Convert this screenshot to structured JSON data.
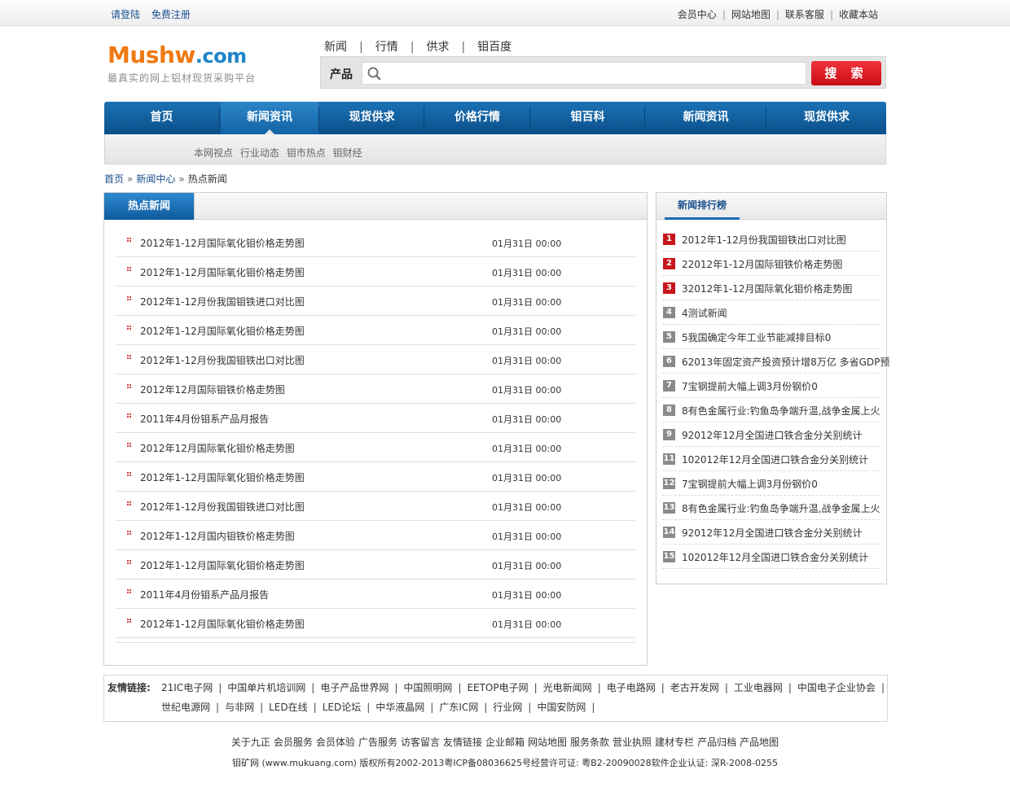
{
  "topbar": {
    "login": "请登陆",
    "register": "免费注册",
    "links": [
      "会员中心",
      "网站地图",
      "联系客服",
      "收藏本站"
    ]
  },
  "logo": {
    "brand_main": "Mushw",
    "brand_suffix": ".com",
    "slogan": "最真实的网上铝材现货采购平台"
  },
  "search": {
    "tabs": [
      "新闻",
      "行情",
      "供求",
      "钼百度"
    ],
    "category": "产品",
    "placeholder": "",
    "button": "搜 索"
  },
  "mainnav": [
    "首页",
    "新闻资讯",
    "现货供求",
    "价格行情",
    "钼百科",
    "新闻资讯",
    "现货供求"
  ],
  "subnav": [
    "本网视点",
    "行业动态",
    "钼市热点",
    "钼财经"
  ],
  "breadcrumb": {
    "home": "首页",
    "center": "新闻中心",
    "current": "热点新闻",
    "separator": "»"
  },
  "hot_news": {
    "title": "热点新闻",
    "items": [
      {
        "title": "2012年1-12月国际氧化钼价格走势图",
        "date": "01月31日 00:00"
      },
      {
        "title": "2012年1-12月国际氧化钼价格走势图",
        "date": "01月31日 00:00"
      },
      {
        "title": "2012年1-12月份我国钼铁进口对比图",
        "date": "01月31日 00:00"
      },
      {
        "title": "2012年1-12月国际氧化钼价格走势图",
        "date": "01月31日 00:00"
      },
      {
        "title": "2012年1-12月份我国钼铁出口对比图",
        "date": "01月31日 00:00"
      },
      {
        "title": "2012年12月国际钼铁价格走势图",
        "date": "01月31日 00:00"
      },
      {
        "title": "2011年4月份钼系产品月报告",
        "date": "01月31日 00:00"
      },
      {
        "title": "2012年12月国际氧化钼价格走势图",
        "date": "01月31日 00:00"
      },
      {
        "title": "2012年1-12月国际氧化钼价格走势图",
        "date": "01月31日 00:00"
      },
      {
        "title": "2012年1-12月份我国钼铁进口对比图",
        "date": "01月31日 00:00"
      },
      {
        "title": "2012年1-12月国内钼铁价格走势图",
        "date": "01月31日 00:00"
      },
      {
        "title": "2012年1-12月国际氧化钼价格走势图",
        "date": "01月31日 00:00"
      },
      {
        "title": "2011年4月份钼系产品月报告",
        "date": "01月31日 00:00"
      },
      {
        "title": "2012年1-12月国际氧化钼价格走势图",
        "date": "01月31日 00:00"
      }
    ]
  },
  "ranking": {
    "title": "新闻排行榜",
    "items": [
      {
        "num": "1",
        "title": "2012年1-12月份我国钼铁出口对比图"
      },
      {
        "num": "2",
        "title": "22012年1-12月国际钼铁价格走势图"
      },
      {
        "num": "3",
        "title": "32012年1-12月国际氧化钼价格走势图"
      },
      {
        "num": "4",
        "title": "4测试新闻"
      },
      {
        "num": "5",
        "title": "5我国确定今年工业节能减排目标0"
      },
      {
        "num": "6",
        "title": "62013年固定资产投资预计增8万亿 多省GDP预"
      },
      {
        "num": "7",
        "title": "7宝钢提前大幅上调3月份钢价0"
      },
      {
        "num": "8",
        "title": "8有色金属行业:钓鱼岛争端升温,战争金属上火"
      },
      {
        "num": "9",
        "title": "92012年12月全国进口铁合金分关别统计"
      },
      {
        "num": "11",
        "title": "102012年12月全国进口铁合金分关别统计"
      },
      {
        "num": "12",
        "title": "7宝钢提前大幅上调3月份钢价0"
      },
      {
        "num": "13",
        "title": "8有色金属行业:钓鱼岛争端升温,战争金属上火"
      },
      {
        "num": "14",
        "title": "92012年12月全国进口铁合金分关别统计"
      },
      {
        "num": "15",
        "title": "102012年12月全国进口铁合金分关别统计"
      }
    ]
  },
  "friends": {
    "label": "友情链接:",
    "row1": [
      "21IC电子网",
      "中国单片机培训网",
      "电子产品世界网",
      "中国照明网",
      "EETOP电子网",
      "光电新闻网",
      "电子电路网",
      "老古开发网",
      "工业电器网",
      "中国电子企业协会"
    ],
    "row2": [
      "世纪电源网",
      "与非网",
      "LED在线",
      "LED论坛",
      "中华液晶网",
      "广东IC网",
      "行业网",
      "中国安防网"
    ]
  },
  "footer": {
    "links": [
      "关于九正",
      "会员服务",
      "会员体验",
      "广告服务",
      "访客留言",
      "友情链接",
      "企业邮箱",
      "网站地图",
      "服务条款",
      "营业执照",
      "建材专栏",
      "产品归档",
      "产品地图"
    ],
    "copyright": "钼矿网 (www.mukuang.com) 版权所有2002-2013粤ICP备08036625号经营许可证: 粤B2-20090028软件企业认证: 深R-2008-0255"
  },
  "colors": {
    "nav_blue": "#0b4f8a",
    "accent_red": "#c8161d",
    "brand_orange": "#f07a12",
    "brand_blue": "#1e84c8"
  }
}
